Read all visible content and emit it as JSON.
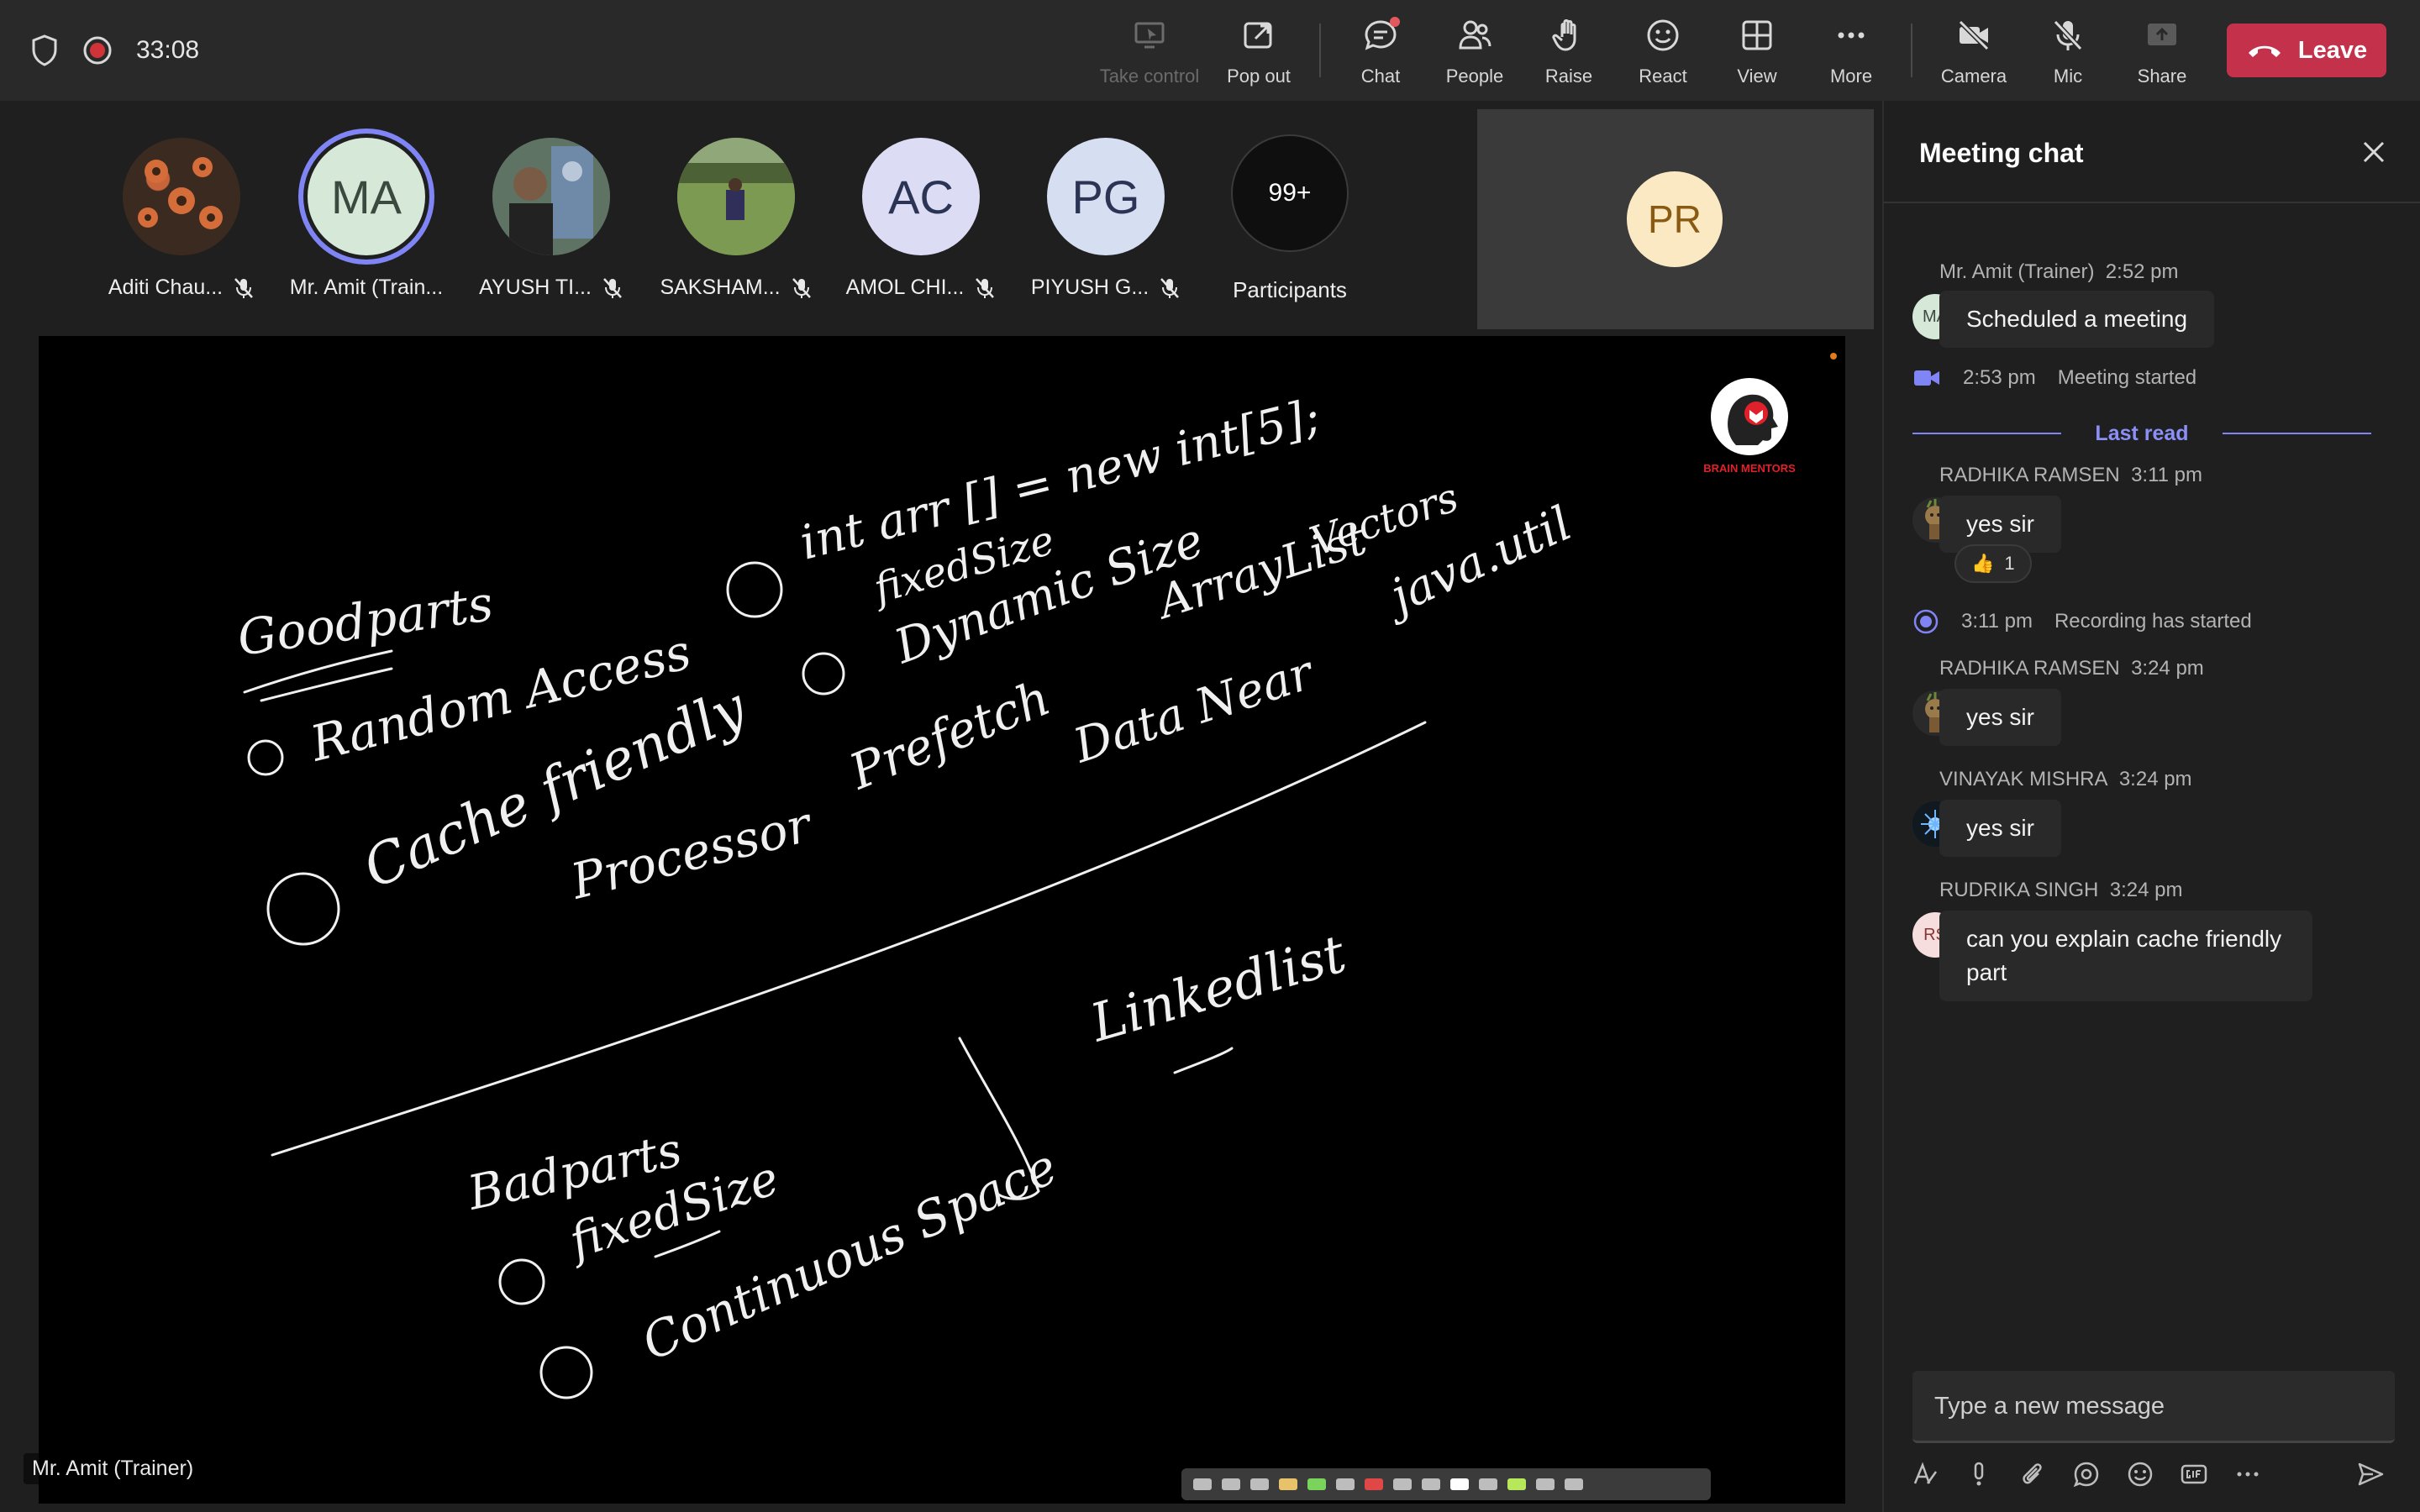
{
  "topbar": {
    "timer": "33:08",
    "buttons": {
      "take_control": "Take control",
      "pop_out": "Pop out",
      "chat": "Chat",
      "people": "People",
      "raise": "Raise",
      "react": "React",
      "view": "View",
      "more": "More",
      "camera": "Camera",
      "mic": "Mic",
      "share": "Share"
    },
    "leave": "Leave"
  },
  "participants": [
    {
      "name": "Aditi Chau...",
      "initials": "",
      "photo": "flowers"
    },
    {
      "name": "Mr. Amit (Train...",
      "initials": "MA",
      "active": true
    },
    {
      "name": "AYUSH TI...",
      "initials": "",
      "photo": "person-statue"
    },
    {
      "name": "SAKSHAM...",
      "initials": "",
      "photo": "field"
    },
    {
      "name": "AMOL CHI...",
      "initials": "AC"
    },
    {
      "name": "PIYUSH G...",
      "initials": "PG"
    }
  ],
  "participants_more": {
    "count": "99+",
    "label": "Participants"
  },
  "pinned_tile": {
    "initials": "PR"
  },
  "stage": {
    "presenter_label": "Mr. Amit (Trainer)",
    "logo_text": "BRAIN MENTORS",
    "notes": {
      "goodparts": "Goodparts",
      "random_access": "Random Access",
      "cache_friendly": "Cache friendly",
      "processor": "Processor",
      "prefetch": "Prefetch",
      "data_near": "Data Near",
      "int_arr": "int arr [] = new int[5];",
      "fixed_size": "fixedSize",
      "dynamic_size": "Dynamic Size",
      "arraylist": "ArrayList",
      "vectors": "Vectors",
      "java_util": "java.util",
      "badparts": "Badparts",
      "fixed_size_2": "fixedSize",
      "continuous_space": "Continuous Space",
      "linkedlist": "Linkedlist"
    }
  },
  "chat": {
    "title": "Meeting chat",
    "composer_placeholder": "Type a new message",
    "last_read": "Last read",
    "messages": [
      {
        "author": "Mr. Amit (Trainer)",
        "time": "2:52 pm",
        "text": "Scheduled a meeting",
        "avatar": "MA"
      },
      {
        "event": true,
        "time": "2:53 pm",
        "text": "Meeting started",
        "icon": "video-icon"
      },
      {
        "author": "RADHIKA RAMSEN",
        "time": "3:11 pm",
        "text": "yes sir",
        "avatar": "groot",
        "reaction": {
          "emoji": "👍",
          "count": "1"
        }
      },
      {
        "event": true,
        "time": "3:11 pm",
        "text": "Recording has started",
        "icon": "record-icon"
      },
      {
        "author": "RADHIKA RAMSEN",
        "time": "3:24 pm",
        "text": "yes sir",
        "avatar": "groot"
      },
      {
        "author": "VINAYAK MISHRA",
        "time": "3:24 pm",
        "text": "yes sir",
        "avatar": "spark"
      },
      {
        "author": "RUDRIKA SINGH",
        "time": "3:24 pm",
        "text": "can you explain cache friendly part",
        "avatar": "RS"
      }
    ]
  },
  "colors": {
    "accent": "#7f85f5",
    "leave": "#c4314b",
    "background": "#1f1f1f",
    "bubble": "#292929"
  }
}
